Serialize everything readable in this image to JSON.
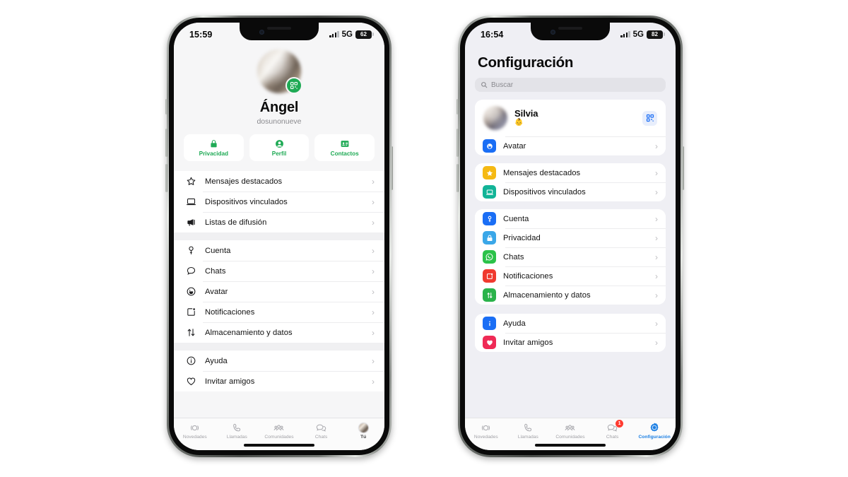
{
  "background_color": "#ffffff",
  "accent_green": "#1faa55",
  "accent_blue": "#1b7fe3",
  "phone_left": {
    "name": "whatsapp-profile-screen",
    "status_bar": {
      "time": "15:59",
      "network": "5G",
      "battery": "62"
    },
    "profile": {
      "name": "Ángel",
      "username": "dosunonueve",
      "qr_badge": "qr-code-icon"
    },
    "quick_actions": [
      {
        "label": "Privacidad",
        "icon": "lock-icon"
      },
      {
        "label": "Perfil",
        "icon": "person-circle-icon"
      },
      {
        "label": "Contactos",
        "icon": "contact-card-icon"
      }
    ],
    "groups": [
      {
        "items": [
          {
            "label": "Mensajes destacados",
            "icon": "star-icon"
          },
          {
            "label": "Dispositivos vinculados",
            "icon": "laptop-icon"
          },
          {
            "label": "Listas de difusión",
            "icon": "megaphone-icon"
          }
        ]
      },
      {
        "items": [
          {
            "label": "Cuenta",
            "icon": "key-icon"
          },
          {
            "label": "Chats",
            "icon": "chat-bubble-icon"
          },
          {
            "label": "Avatar",
            "icon": "avatar-icon"
          },
          {
            "label": "Notificaciones",
            "icon": "notification-icon"
          },
          {
            "label": "Almacenamiento y datos",
            "icon": "arrows-updown-icon"
          }
        ]
      },
      {
        "items": [
          {
            "label": "Ayuda",
            "icon": "info-circle-icon"
          },
          {
            "label": "Invitar amigos",
            "icon": "heart-icon"
          }
        ]
      }
    ],
    "tabs": [
      {
        "label": "Novedades",
        "icon": "updates-icon",
        "active": false,
        "badge": ""
      },
      {
        "label": "Llamadas",
        "icon": "phone-icon",
        "active": false,
        "badge": ""
      },
      {
        "label": "Comunidades",
        "icon": "communities-icon",
        "active": false,
        "badge": ""
      },
      {
        "label": "Chats",
        "icon": "chats-icon",
        "active": false,
        "badge": ""
      },
      {
        "label": "Tú",
        "icon": "profile-avatar-icon",
        "active": true,
        "badge": ""
      }
    ]
  },
  "phone_right": {
    "name": "whatsapp-settings-screen",
    "status_bar": {
      "time": "16:54",
      "network": "5G",
      "battery": "82"
    },
    "title": "Configuración",
    "search": {
      "placeholder": "Buscar",
      "icon": "search-icon"
    },
    "profile": {
      "name": "Silvia",
      "status_emoji": "👶",
      "qr_button": "qr-code-icon"
    },
    "groups": [
      {
        "items": [
          {
            "label": "Avatar",
            "icon": "avatar-icon",
            "color": "#1a6ef5"
          }
        ]
      },
      {
        "items": [
          {
            "label": "Mensajes destacados",
            "icon": "star-icon",
            "color": "#f5b913"
          },
          {
            "label": "Dispositivos vinculados",
            "icon": "laptop-icon",
            "color": "#12b497"
          }
        ]
      },
      {
        "items": [
          {
            "label": "Cuenta",
            "icon": "key-icon",
            "color": "#1a6ef5"
          },
          {
            "label": "Privacidad",
            "icon": "lock-icon",
            "color": "#3aa7e8"
          },
          {
            "label": "Chats",
            "icon": "whatsapp-icon",
            "color": "#2bc249"
          },
          {
            "label": "Notificaciones",
            "icon": "notification-icon",
            "color": "#f03a2f"
          },
          {
            "label": "Almacenamiento y datos",
            "icon": "arrows-updown-icon",
            "color": "#2ab34a"
          }
        ]
      },
      {
        "items": [
          {
            "label": "Ayuda",
            "icon": "info-icon",
            "color": "#1a6ef5"
          },
          {
            "label": "Invitar amigos",
            "icon": "heart-icon",
            "color": "#ef2a56"
          }
        ]
      }
    ],
    "tabs": [
      {
        "label": "Novedades",
        "icon": "updates-icon",
        "active": false,
        "badge": ""
      },
      {
        "label": "Llamadas",
        "icon": "phone-icon",
        "active": false,
        "badge": ""
      },
      {
        "label": "Comunidades",
        "icon": "communities-icon",
        "active": false,
        "badge": ""
      },
      {
        "label": "Chats",
        "icon": "chats-icon",
        "active": false,
        "badge": "1"
      },
      {
        "label": "Configuración",
        "icon": "gear-icon",
        "active": true,
        "badge": ""
      }
    ]
  }
}
